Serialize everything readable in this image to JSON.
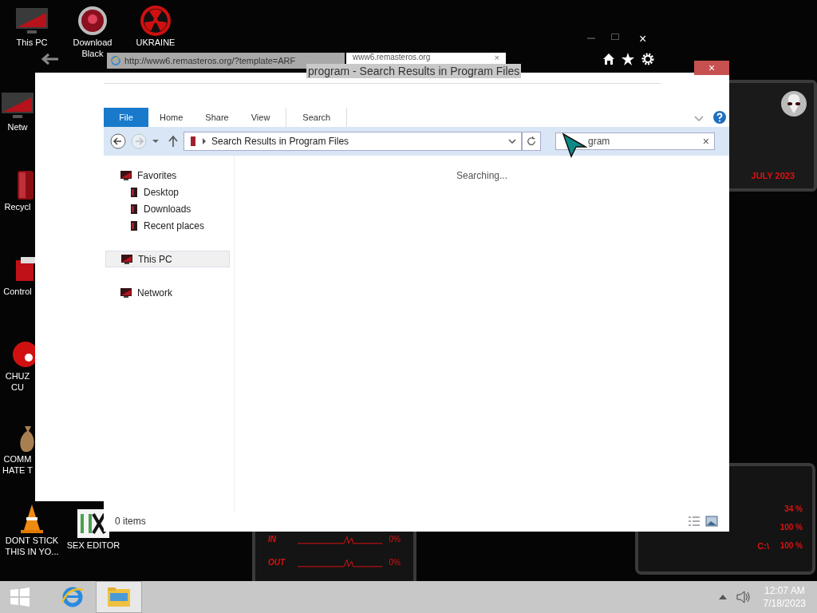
{
  "desktop_icons": [
    {
      "kind": "monitor",
      "lines": [
        "This PC"
      ]
    },
    {
      "kind": "orb",
      "lines": [
        "Download",
        "Black"
      ]
    },
    {
      "kind": "radiation",
      "lines": [
        "UKRAINE"
      ]
    },
    {
      "kind": "monitor",
      "lines": [
        "Netw"
      ]
    },
    {
      "kind": "bin",
      "lines": [
        "Recycl"
      ]
    },
    {
      "kind": "panel",
      "lines": [
        "Control"
      ]
    },
    {
      "kind": "blob",
      "lines": [
        "CHUZ",
        "CU"
      ]
    },
    {
      "kind": "moneybag",
      "lines": [
        "COMM",
        "HATE T"
      ]
    },
    {
      "kind": "cone",
      "lines": [
        "DONT STICK",
        "THIS IN YO..."
      ]
    },
    {
      "kind": "hx",
      "lines": [
        "SEX EDITOR"
      ]
    }
  ],
  "browser": {
    "url": "http://www6.remasteros.org/?template=ARF",
    "tab": "www6.remasteros.org",
    "tab_close": "×",
    "close": "×"
  },
  "explorer": {
    "title": "program - Search Results in Program Files",
    "close": "×",
    "ribbon_tabs": [
      {
        "label": "File",
        "selected": true
      },
      {
        "label": "Home",
        "selected": false
      },
      {
        "label": "Share",
        "selected": false
      },
      {
        "label": "View",
        "selected": false
      },
      {
        "label": "Search",
        "selected": false
      }
    ],
    "address": "Search Results in Program Files",
    "search": {
      "value": "gram",
      "clear": "×"
    },
    "nav": [
      {
        "label": "Favorites",
        "kind": "group",
        "selected": false
      },
      {
        "label": "Desktop",
        "kind": "item",
        "selected": false
      },
      {
        "label": "Downloads",
        "kind": "item",
        "selected": false
      },
      {
        "label": "Recent places",
        "kind": "item",
        "selected": false
      },
      {
        "label": "This PC",
        "kind": "group",
        "selected": true
      },
      {
        "label": "Network",
        "kind": "group",
        "selected": false
      }
    ],
    "status": "Searching...",
    "item_count": "0 items"
  },
  "gadgets": {
    "date": "JULY 2023",
    "drives": [
      {
        "value": "34 %"
      },
      {
        "value": "100 %"
      },
      {
        "label": "C:\\",
        "value": "100 %"
      }
    ],
    "network": [
      {
        "label": "IN",
        "value": "0%"
      },
      {
        "label": "OUT",
        "value": "0%"
      }
    ]
  },
  "taskbar": {
    "apps": [
      {
        "kind": "ie",
        "selected": false
      },
      {
        "kind": "folder",
        "selected": true
      }
    ],
    "time": "12:07 AM",
    "date": "7/18/2023"
  }
}
